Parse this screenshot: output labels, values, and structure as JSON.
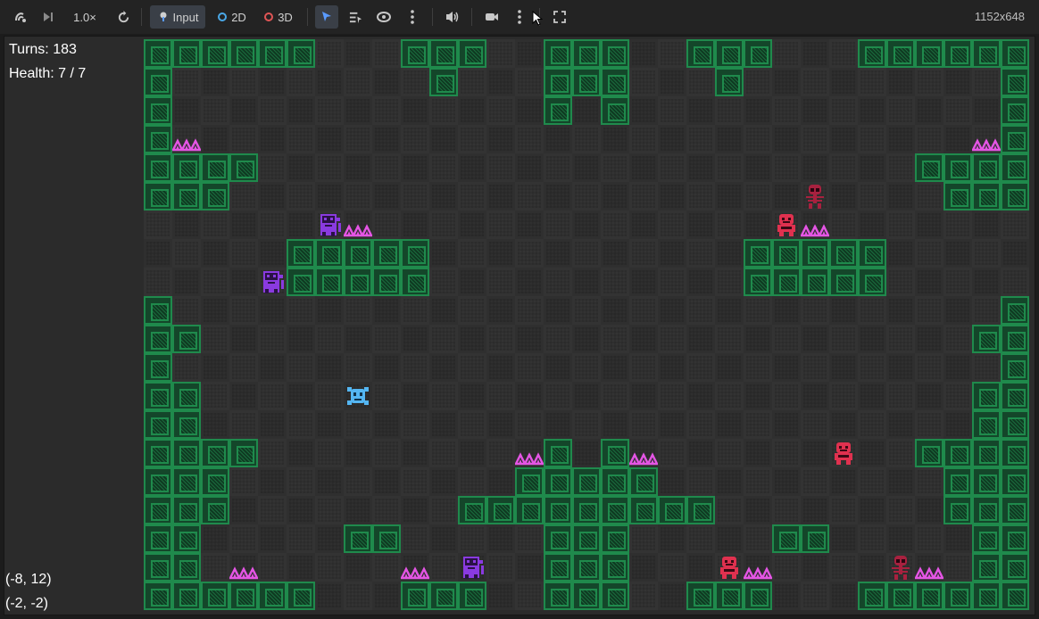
{
  "toolbar": {
    "speed_label": "1.0×",
    "input_label": "Input",
    "mode_2d_label": "2D",
    "mode_3d_label": "3D",
    "resolution": "1152x648",
    "colors": {
      "accent": "#5a9bff",
      "ring_2d": "#4aa8e8",
      "ring_3d": "#e05555"
    }
  },
  "hud": {
    "turns": "Turns: 183",
    "health": "Health: 7 / 7",
    "coord_primary": "(-8, 12)",
    "coord_secondary": "(-2, -2)"
  },
  "board": {
    "cols": 31,
    "rows": 20,
    "walls": [
      "WWWWWW.....WWW.....WWW.....WWW.....WWWWWW",
      "W..........W.......WWW......W..........W",
      "W..................W.W.................W",
      "W......................................W",
      "WWWW.............................WWWW",
      "WWW...............................WWW",
      "...............................",
      ".....WWWWW.................WWWWW.....",
      ".....WWWWW.................WWWWW.....",
      "W.............................W",
      "WW...........................WW",
      "W.............................W",
      "WW...........................WW",
      "WW...........................WW",
      "WWWW...........W.W.........WWWW",
      "WWW...........WWWWW.........WWW",
      "WWW.........WWWWWWWWW.......WWW",
      "WW.......WW......WWW.......WW..WW",
      "WW...................W.W......WW",
      "WWWWWW.....WWW.....WWW.....WWWWWW"
    ],
    "entities": [
      {
        "kind": "spikes",
        "color": "#e455e4"
      },
      {
        "kind": "purple-ghoul",
        "color": "#8a3ae0"
      },
      {
        "kind": "red-goblin",
        "color": "#e0314f"
      },
      {
        "kind": "dark-red-skeleton",
        "color": "#a8213f"
      },
      {
        "kind": "player",
        "color": "#54b6f2"
      }
    ]
  }
}
